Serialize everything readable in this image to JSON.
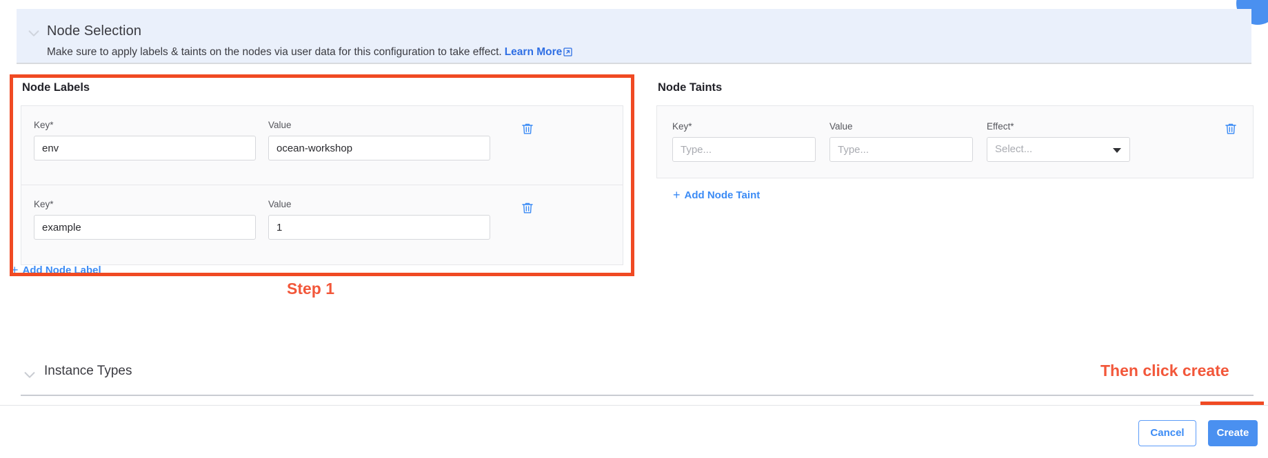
{
  "notice": {
    "chevron_icon": "chevron-down-icon",
    "title": "Node Selection",
    "description": "Make sure to apply labels & taints on the nodes via user data for this configuration to take effect.",
    "link_label": "Learn More",
    "link_icon": "external-link-icon",
    "background_color": "#eaf0fb",
    "link_color": "#2f6fe4"
  },
  "node_labels": {
    "section_title": "Node Labels",
    "key_label": "Key*",
    "value_label": "Value",
    "delete_icon": "trash-icon",
    "rows": [
      {
        "key": "env",
        "value": "ocean-workshop"
      },
      {
        "key": "example",
        "value": "1"
      }
    ],
    "add_link": "Add Node Label",
    "add_icon": "plus-icon"
  },
  "node_taints": {
    "section_title": "Node Taints",
    "key_label": "Key*",
    "value_label": "Value",
    "effect_label": "Effect*",
    "key_placeholder": "Type...",
    "value_placeholder": "Type...",
    "effect_placeholder": "Select...",
    "key_value": "",
    "value_value": "",
    "delete_icon": "trash-icon",
    "caret_icon": "chevron-down-icon",
    "add_link": "Add Node Taint",
    "add_icon": "plus-icon"
  },
  "instance_types": {
    "chevron_icon": "chevron-down-icon",
    "title": "Instance Types"
  },
  "footer": {
    "cancel_label": "Cancel",
    "create_label": "Create",
    "create_color": "#4a90f0",
    "cancel_color": "#3b8bf5"
  },
  "annotations": {
    "step1": "Step 1",
    "then_click_create": "Then click create",
    "highlight_color": "#f04a23"
  }
}
